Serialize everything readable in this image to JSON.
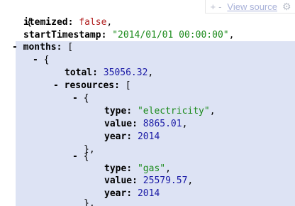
{
  "toolbar": {
    "expand_label": "+",
    "collapse_label": "-",
    "view_source_label": "View source",
    "settings_icon": "gear-icon",
    "settings_glyph": "⚙"
  },
  "json": {
    "open_brace": "{",
    "itemized_key": "itemized:",
    "itemized_value": "false",
    "start_key": "startTimestamp:",
    "start_value": "\"2014/01/01 00:00:00\"",
    "months_key": "months:",
    "months_open": "[",
    "month0_open": "{",
    "total_key": "total:",
    "total_value": "35056.32",
    "resources_key": "resources:",
    "resources_open": "[",
    "res0_open": "{",
    "res0_type_key": "type:",
    "res0_type_value": "\"electricity\"",
    "res0_value_key": "value:",
    "res0_value_value": "8865.01",
    "res0_year_key": "year:",
    "res0_year_value": "2014",
    "res0_close": "},",
    "res1_open": "{",
    "res1_type_key": "type:",
    "res1_type_value": "\"gas\"",
    "res1_value_key": "value:",
    "res1_value_value": "25579.57",
    "res1_year_key": "year:",
    "res1_year_value": "2014",
    "res1_close": "},",
    "collapse_toggle": "-",
    "comma": ","
  },
  "colors": {
    "highlight": "#dde3f4",
    "boolean": "#b22222",
    "string": "#1a8a1a",
    "number": "#1a1aa6",
    "link": "#a9b2d9"
  }
}
